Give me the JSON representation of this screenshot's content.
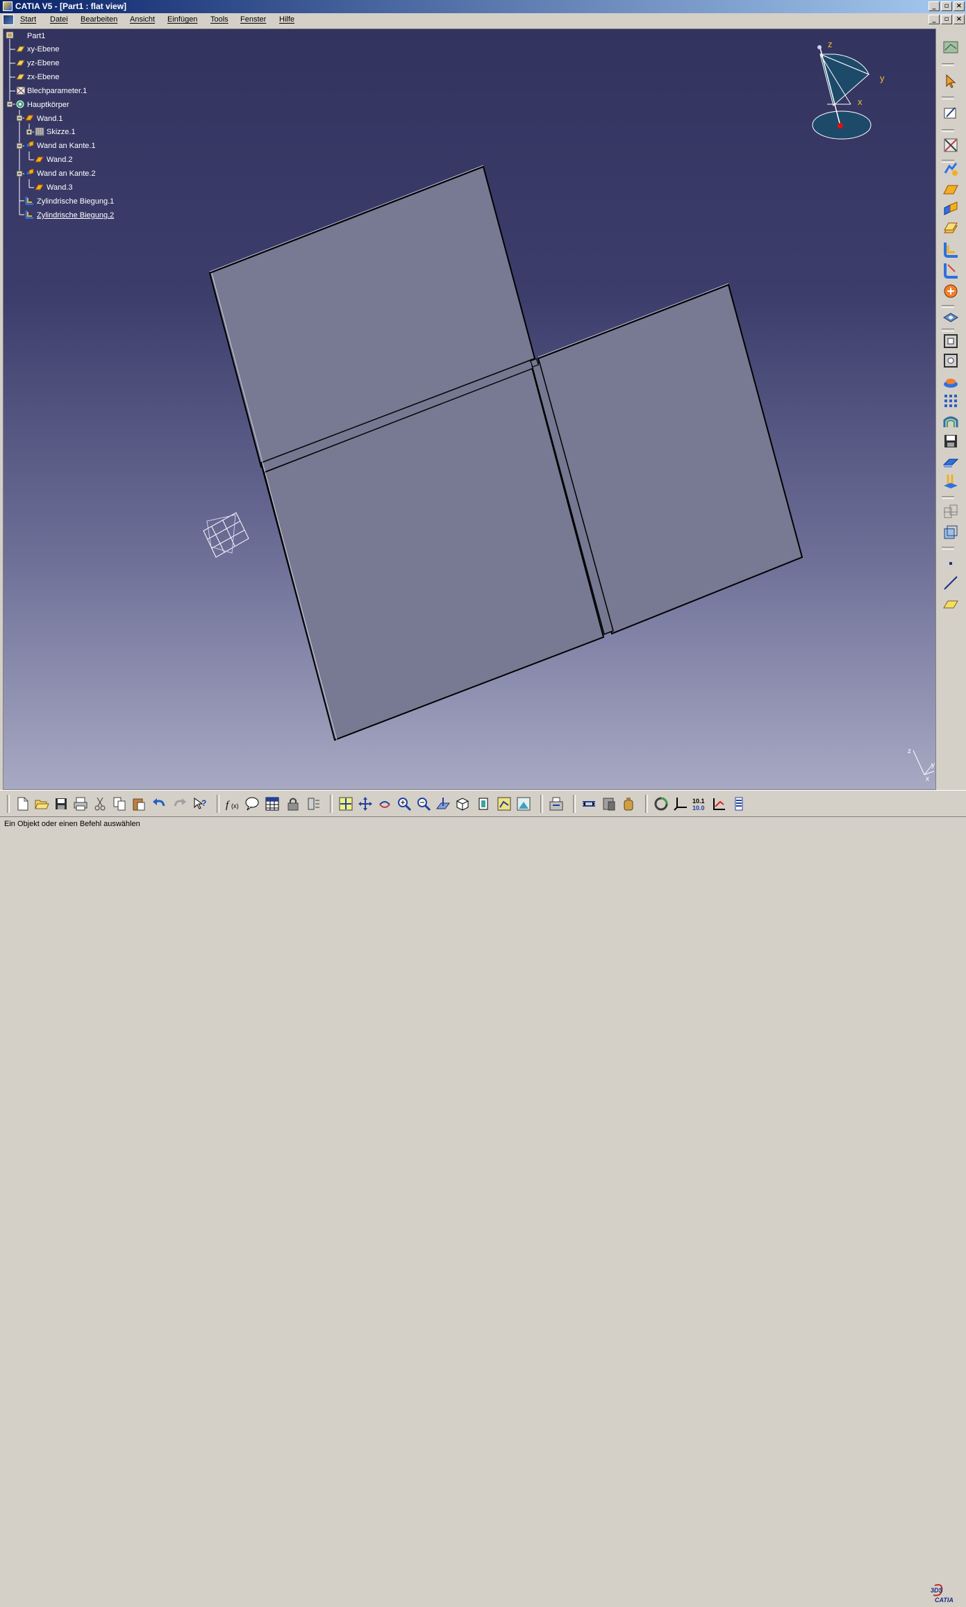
{
  "window": {
    "title": "CATIA V5 - [Part1 : flat view]"
  },
  "menu": {
    "items": [
      "Start",
      "Datei",
      "Bearbeiten",
      "Ansicht",
      "Einfügen",
      "Tools",
      "Fenster",
      "Hilfe"
    ]
  },
  "tree": {
    "nodes": [
      {
        "label": "Part1",
        "icon": "part-icon"
      },
      {
        "label": "xy-Ebene",
        "icon": "plane-icon"
      },
      {
        "label": "yz-Ebene",
        "icon": "plane-icon"
      },
      {
        "label": "zx-Ebene",
        "icon": "plane-icon"
      },
      {
        "label": "Blechparameter.1",
        "icon": "sheetmetal-parameters-icon"
      },
      {
        "label": "Hauptkörper",
        "icon": "body-icon"
      },
      {
        "label": "Wand.1",
        "icon": "wall-icon"
      },
      {
        "label": "Skizze.1",
        "icon": "sketch-icon"
      },
      {
        "label": "Wand an Kante.1",
        "icon": "wall-on-edge-icon"
      },
      {
        "label": "Wand.2",
        "icon": "wall-icon"
      },
      {
        "label": "Wand an Kante.2",
        "icon": "wall-on-edge-icon"
      },
      {
        "label": "Wand.3",
        "icon": "wall-icon"
      },
      {
        "label": "Zylindrische Biegung.1",
        "icon": "cylindrical-bend-icon"
      },
      {
        "label": "Zylindrische Biegung.2",
        "icon": "cylindrical-bend-icon",
        "selected": true
      }
    ]
  },
  "compass": {
    "axis_x": "x",
    "axis_y": "y",
    "axis_z": "z"
  },
  "axis_triad": {
    "z": "z",
    "x": "x",
    "y": "y"
  },
  "status": {
    "text": "Ein Objekt oder einen Befehl auswählen"
  },
  "logo": {
    "text": "CATIA",
    "mark": "3DS"
  },
  "right_toolbar": {
    "icons": [
      "compass-view-icon",
      "select-arrow-icon",
      "sketcher-icon",
      "sheetmetal-parameters-icon",
      "recognize-icon",
      "wall-icon",
      "wall-on-edge-icon",
      "extrusion-icon",
      "flange-icon",
      "bend-icon",
      "cylindrical-bend-icon",
      "unfold-icon",
      "cut-out-icon",
      "hole-icon",
      "stamp-icon",
      "pattern-icon",
      "corner-relief-icon",
      "save-dxf-icon",
      "surface-stamp-icon",
      "bead-icon",
      "3d-wireframe-icon",
      "part-body-icon",
      "point-icon",
      "line-icon",
      "plane-icon"
    ]
  },
  "bottom_toolbar": {
    "icons": [
      "new-icon",
      "open-icon",
      "save-icon",
      "print-icon",
      "cut-icon",
      "copy-icon",
      "paste-icon",
      "undo-icon",
      "redo-icon",
      "whats-this-icon",
      "formula-icon",
      "comment-icon",
      "table-icon",
      "lock-icon",
      "measure-icon",
      "fit-all-icon",
      "pan-icon",
      "rotate-icon",
      "zoom-in-icon",
      "zoom-out-icon",
      "normal-view-icon",
      "iso-view-icon",
      "hide-show-icon",
      "swap-space-icon",
      "shading-icon",
      "multi-view-icon",
      "measure-between-icon",
      "measure-item-icon",
      "mass-properties-icon",
      "update-icon",
      "axis-system-icon",
      "unit-icon",
      "catalog-icon",
      "properties-icon"
    ]
  }
}
